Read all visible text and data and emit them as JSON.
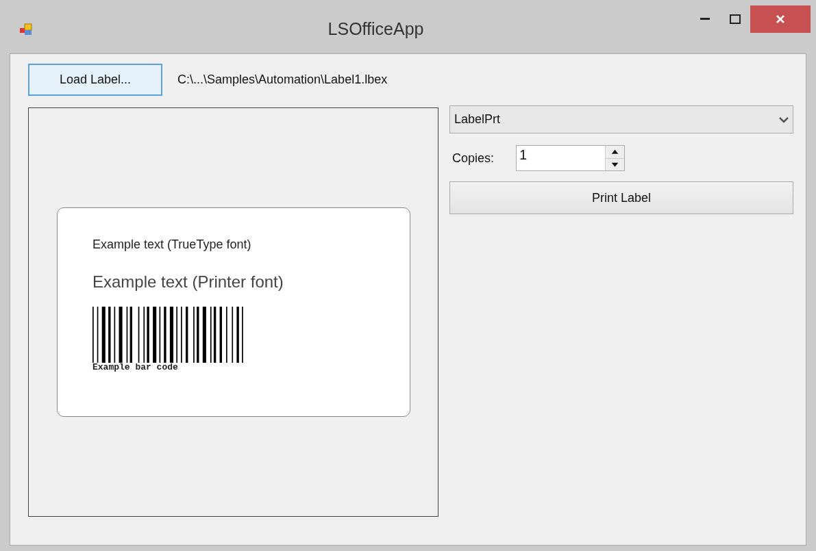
{
  "window": {
    "title": "LSOfficeApp"
  },
  "load_button": {
    "label": "Load Label..."
  },
  "file_path": "C:\\...\\Samples\\Automation\\Label1.lbex",
  "preview": {
    "truetype_text": "Example text (TrueType font)",
    "printer_text": "Example text (Printer font)",
    "barcode_caption": "Example bar code"
  },
  "printer_select": {
    "value": "LabelPrt"
  },
  "copies": {
    "label": "Copies:",
    "value": "1"
  },
  "print_button": {
    "label": "Print Label"
  }
}
